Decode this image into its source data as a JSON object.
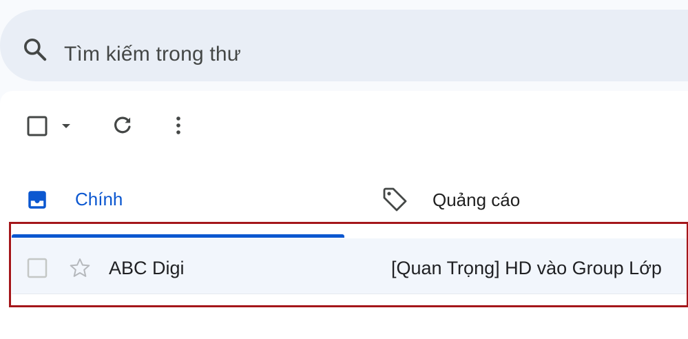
{
  "search": {
    "placeholder": "Tìm kiếm trong thư",
    "icon": "search-icon"
  },
  "toolbar": {
    "icons": [
      "checkbox-icon",
      "caret-down-icon",
      "refresh-icon",
      "more-vert-icon"
    ]
  },
  "tabs": [
    {
      "label": "Chính",
      "icon": "inbox-icon",
      "active": true,
      "color": "#0b57d0"
    },
    {
      "label": "Quảng cáo",
      "icon": "tag-icon",
      "active": false
    }
  ],
  "emails": [
    {
      "sender": "ABC Digi",
      "subject": "[Quan Trọng] HD vào Group Lớp",
      "starred": false,
      "selected": false
    }
  ],
  "colors": {
    "accent": "#0b57d0",
    "search_bg": "#e9eef6",
    "row_bg": "#f2f6fc",
    "highlight": "#a4161a"
  }
}
